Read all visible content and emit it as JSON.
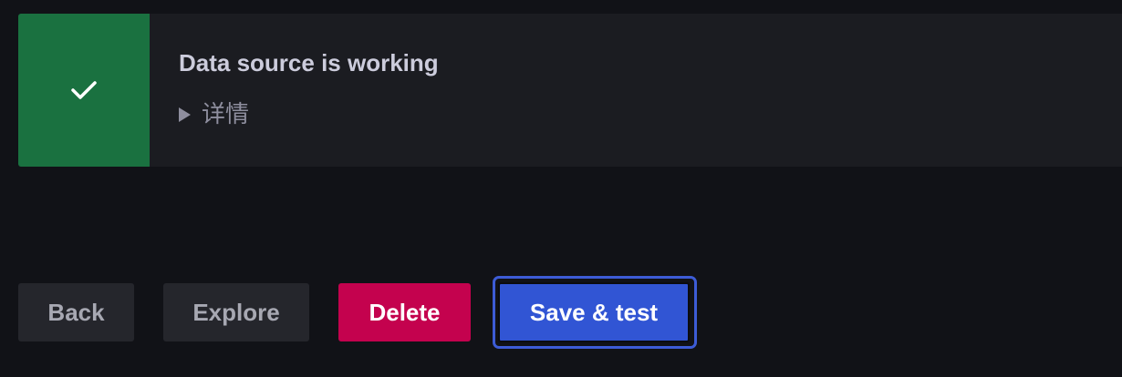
{
  "alert": {
    "status": "success",
    "icon": "checkmark-icon",
    "title": "Data source is working",
    "details_label": "详情"
  },
  "actions": {
    "back_label": "Back",
    "explore_label": "Explore",
    "delete_label": "Delete",
    "save_test_label": "Save & test"
  },
  "colors": {
    "success": "#1a7140",
    "danger": "#c4024e",
    "primary": "#3155d4",
    "background": "#111217",
    "panel": "#1b1c21"
  }
}
